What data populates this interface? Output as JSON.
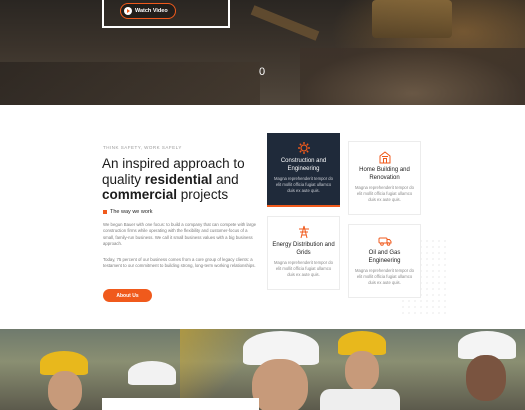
{
  "hero": {
    "watch_label": "Watch Video",
    "counter": "0"
  },
  "about": {
    "eyebrow": "Think safety, work safely",
    "headline_part1": "An inspired approach to quality ",
    "headline_bold1": "residential",
    "headline_part2": " and ",
    "headline_bold2": "commercial",
    "headline_part3": " projects",
    "subhead": "The way we work",
    "para1": "We begun Bauer with one focus: to build a company that can compete with large construction firms while operating with the flexibility and customer-focus of a small, family-run business. We call it small business values with a big business approach.",
    "para2": "Today, 75 percent of our business comes from a core group of legacy clients: a testament to our commitment to building strong, long-term working relationships.",
    "button": "About Us"
  },
  "services": [
    {
      "title": "Construction and Engineering",
      "desc": "Magna reprehenderit tempor do elit mollit officia fugiat ullamco duis ex aute quis.",
      "icon": "gear-icon"
    },
    {
      "title": "Home Building and Renovation",
      "desc": "Magna reprehenderit tempor do elit mollit officia fugiat ullamco duis ex aute quis.",
      "icon": "building-icon"
    },
    {
      "title": "Energy Distribution and Grids",
      "desc": "Magna reprehenderit tempor do elit mollit officia fugiat ullamco duis ex aute quis.",
      "icon": "pylon-icon"
    },
    {
      "title": "Oil and Gas Engineering",
      "desc": "Magna reprehenderit tempor do elit mollit officia fugiat ullamco duis ex aute quis.",
      "icon": "truck-icon"
    }
  ],
  "colors": {
    "accent": "#f05a1c",
    "dark_card": "#1f2a3a"
  }
}
